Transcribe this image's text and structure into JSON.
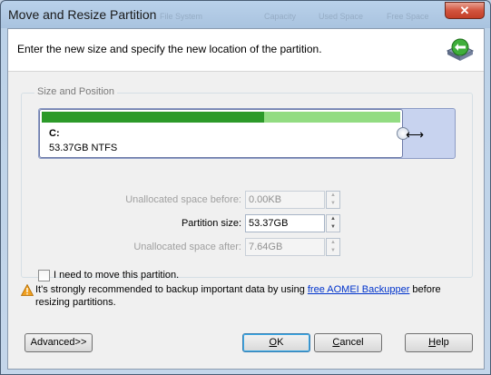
{
  "window": {
    "title": "Move and Resize Partition",
    "close_label": "✕",
    "background_hints": [
      "File System",
      "Capacity",
      "Used Space",
      "Free Space"
    ]
  },
  "header": {
    "instruction": "Enter the new size and specify the new location of the partition.",
    "icon": "partition-arrow-icon"
  },
  "size_position": {
    "legend": "Size and Position",
    "partition": {
      "letter": "C:",
      "info": "53.37GB NTFS",
      "used_fraction": 0.62,
      "partition_fraction": 0.875
    },
    "fields": {
      "unalloc_before": {
        "label": "Unallocated space before:",
        "value": "0.00KB",
        "enabled": false
      },
      "partition_size": {
        "label": "Partition size:",
        "value": "53.37GB",
        "enabled": true
      },
      "unalloc_after": {
        "label": "Unallocated space after:",
        "value": "7.64GB",
        "enabled": false
      }
    },
    "move_checkbox": {
      "label": "I need to move this partition.",
      "checked": false
    }
  },
  "warning": {
    "text_before": "It's strongly recommended to backup important data by using ",
    "link": "free AOMEI Backupper",
    "text_after": " before resizing partitions."
  },
  "buttons": {
    "advanced": "Advanced>>",
    "ok_mnemonic": "O",
    "ok_rest": "K",
    "cancel_mnemonic": "C",
    "cancel_rest": "ancel",
    "help_mnemonic": "H",
    "help_rest": "elp"
  },
  "colors": {
    "bar_used": "#2c9a29",
    "bar_free": "#92dc82",
    "track": "#c8d3ef",
    "link": "#0033cc"
  }
}
